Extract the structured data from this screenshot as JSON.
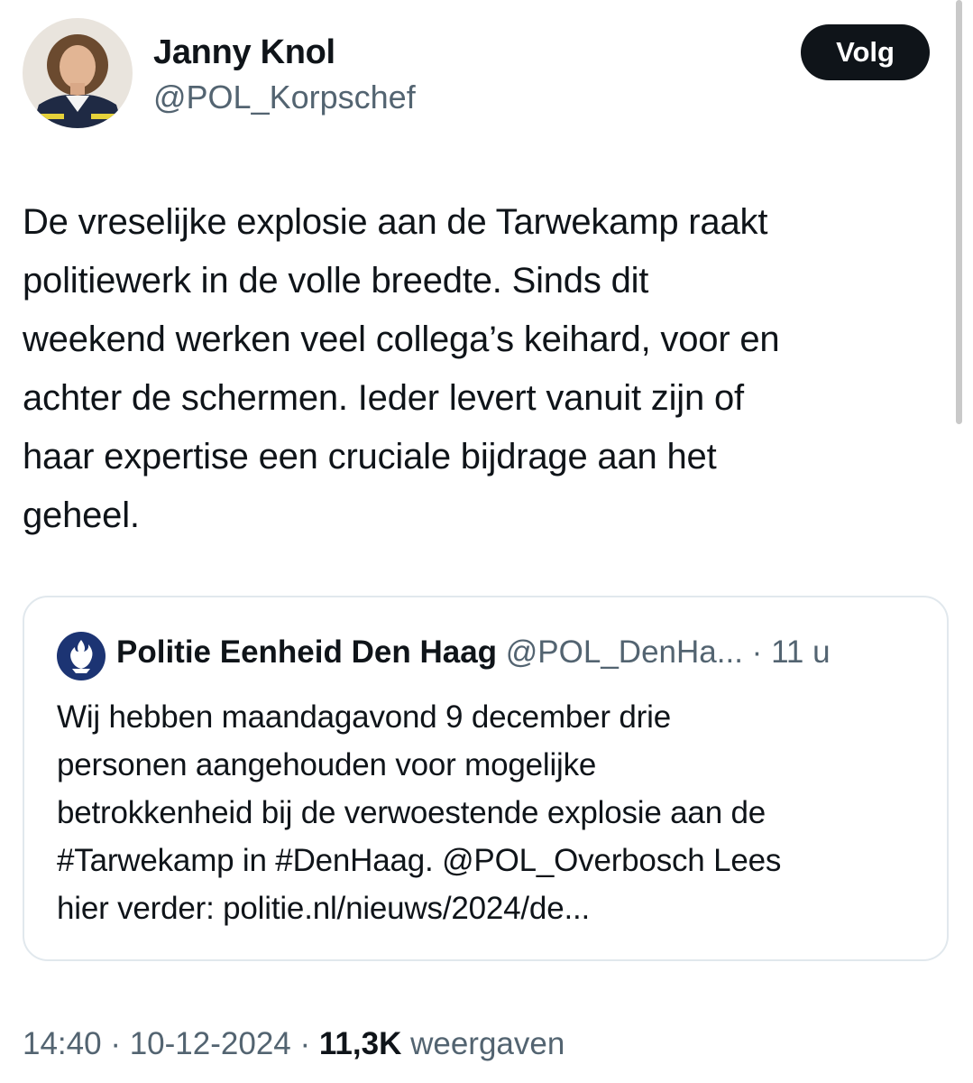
{
  "author": {
    "name": "Janny Knol",
    "handle": "@POL_Korpschef",
    "avatar_icon": "profile-photo"
  },
  "follow_button": {
    "label": "Volg"
  },
  "tweet": {
    "text_lines": [
      "De vreselijke explosie aan de Tarwekamp raakt",
      "politiewerk in de volle breedte. Sinds dit",
      "weekend werken veel collega’s keihard, voor en",
      "achter de schermen. Ieder levert vanuit zijn of",
      "haar expertise een cruciale bijdrage aan het",
      "geheel."
    ]
  },
  "quote": {
    "logo_icon": "police-logo-icon",
    "name": "Politie Eenheid Den Haag",
    "handle": "@POL_DenHa...",
    "separator": "·",
    "time": "11 u",
    "text_lines": [
      "Wij hebben maandagavond 9 december drie",
      "personen aangehouden voor mogelijke",
      "betrokkenheid bij de verwoestende explosie aan de",
      "#Tarwekamp in #DenHaag. @POL_Overbosch Lees",
      "hier verder: politie.nl/nieuws/2024/de..."
    ]
  },
  "meta": {
    "time": "14:40",
    "separator": "·",
    "date": "10-12-2024",
    "views_count": "11,3K",
    "views_label": "weergaven"
  },
  "colors": {
    "text_primary": "#0f1419",
    "text_secondary": "#536471",
    "border": "#e1e8ed",
    "police_blue": "#1c3473"
  }
}
